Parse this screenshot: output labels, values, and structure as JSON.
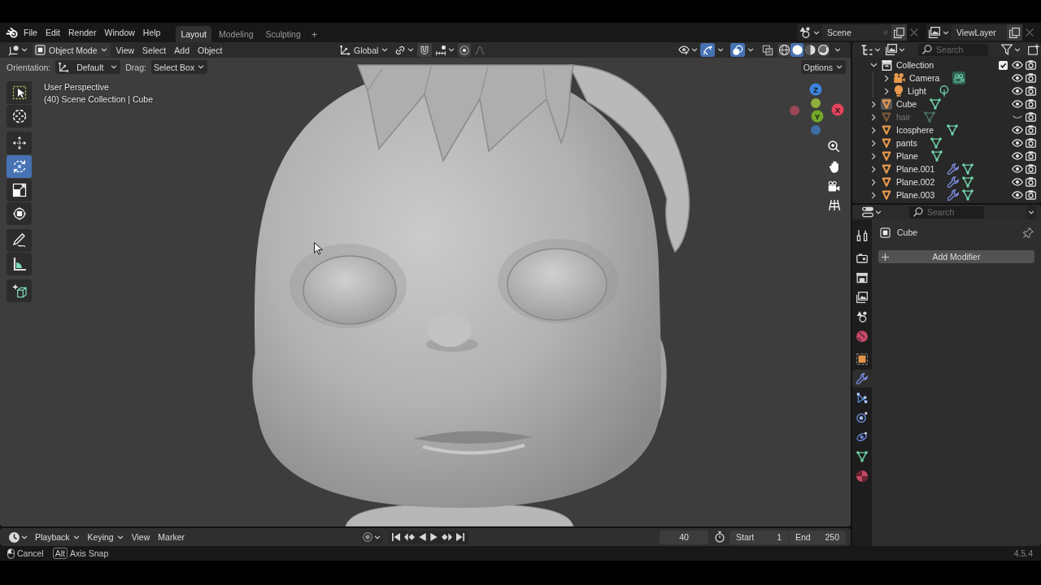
{
  "top_bar": {
    "menus": [
      "File",
      "Edit",
      "Render",
      "Window",
      "Help"
    ],
    "workspaces": [
      {
        "label": "Layout",
        "selected": true
      },
      {
        "label": "Modeling",
        "selected": false
      },
      {
        "label": "Sculpting",
        "selected": false
      }
    ],
    "add_workspace": "+",
    "scene": "Scene",
    "view_layer": "ViewLayer"
  },
  "viewport_header": {
    "mode": "Object Mode",
    "menus": [
      "View",
      "Select",
      "Add",
      "Object"
    ],
    "orientation": "Global",
    "toggles": [
      {
        "kind": "visibility",
        "on": false
      },
      {
        "kind": "gizmos",
        "on": true
      },
      {
        "kind": "overlays",
        "on": true
      },
      {
        "kind": "xray",
        "on": false
      }
    ],
    "shading": [
      {
        "kind": "wireframe",
        "selected": false
      },
      {
        "kind": "solid",
        "selected": true
      },
      {
        "kind": "material",
        "selected": false
      },
      {
        "kind": "rendered",
        "selected": false
      }
    ]
  },
  "tool_settings": {
    "orientation_label": "Orientation:",
    "orientation": "Default",
    "drag_label": "Drag:",
    "drag": "Select Box",
    "options": "Options"
  },
  "toolbar": {
    "groups": [
      [
        {
          "kind": "select_box",
          "selected": false
        },
        {
          "kind": "cursor",
          "selected": false
        }
      ],
      [
        {
          "kind": "move",
          "selected": false
        },
        {
          "kind": "rotate",
          "selected": true
        },
        {
          "kind": "scale",
          "selected": false
        },
        {
          "kind": "transform",
          "selected": false
        }
      ],
      [
        {
          "kind": "annotate",
          "selected": false
        },
        {
          "kind": "measure",
          "selected": false
        }
      ],
      [
        {
          "kind": "add_cube",
          "selected": false
        }
      ]
    ]
  },
  "viewport": {
    "info": [
      "User Perspective",
      "(40) Scene Collection | Cube"
    ],
    "gizmo": [
      {
        "label": "Z",
        "color": "#3c84dc"
      },
      {
        "color": "#8fae3c"
      },
      {
        "label": "X",
        "color": "#e2445c"
      },
      {
        "color": "#9c4656"
      },
      {
        "label": "Y",
        "color": "#72a82a"
      },
      {
        "color": "#3f6ea6"
      }
    ]
  },
  "outliner": {
    "search_placeholder": "Search",
    "tree": [
      {
        "kind": "collection",
        "name": "Collection",
        "expanded": true,
        "checked": true,
        "visible": true,
        "active": false,
        "children": [
          {
            "kind": "camera",
            "name": "Camera",
            "expanded": false,
            "visible": true,
            "active": false
          },
          {
            "kind": "light",
            "name": "Light",
            "expanded": false,
            "visible": true,
            "active": false
          }
        ]
      },
      {
        "kind": "mesh",
        "name": "Cube",
        "expanded": false,
        "visible": true,
        "active": true,
        "modifiers": false
      },
      {
        "kind": "mesh",
        "name": "hair",
        "expanded": false,
        "visible": false,
        "active": false,
        "modifiers": false
      },
      {
        "kind": "mesh",
        "name": "Icosphere",
        "expanded": false,
        "visible": true,
        "active": false,
        "modifiers": false
      },
      {
        "kind": "mesh",
        "name": "pants",
        "expanded": false,
        "visible": true,
        "active": false,
        "modifiers": false
      },
      {
        "kind": "mesh",
        "name": "Plane",
        "expanded": false,
        "visible": true,
        "active": false,
        "modifiers": false
      },
      {
        "kind": "mesh",
        "name": "Plane.001",
        "expanded": false,
        "visible": true,
        "active": false,
        "modifiers": true
      },
      {
        "kind": "mesh",
        "name": "Plane.002",
        "expanded": false,
        "visible": true,
        "active": false,
        "modifiers": true
      },
      {
        "kind": "mesh",
        "name": "Plane.003",
        "expanded": false,
        "visible": true,
        "active": false,
        "modifiers": true
      }
    ]
  },
  "properties": {
    "search_placeholder": "Search",
    "tab_groups": [
      [
        {
          "kind": "tool",
          "selected": false
        }
      ],
      [
        {
          "kind": "render",
          "selected": false
        },
        {
          "kind": "output",
          "selected": false
        },
        {
          "kind": "view_layer",
          "selected": false
        },
        {
          "kind": "scene",
          "selected": false
        },
        {
          "kind": "world",
          "selected": false
        }
      ],
      [
        {
          "kind": "object",
          "selected": false
        },
        {
          "kind": "modifiers",
          "selected": true
        },
        {
          "kind": "particles",
          "selected": false
        },
        {
          "kind": "physics",
          "selected": false
        },
        {
          "kind": "constraints",
          "selected": false
        },
        {
          "kind": "data",
          "selected": false
        },
        {
          "kind": "material",
          "selected": false
        }
      ]
    ],
    "object_name": "Cube",
    "add_modifier": "Add Modifier"
  },
  "timeline": {
    "menus": [
      {
        "label": "Playback",
        "dropdown": true
      },
      {
        "label": "Keying",
        "dropdown": true
      },
      {
        "label": "View",
        "dropdown": false
      },
      {
        "label": "Marker",
        "dropdown": false
      }
    ],
    "auto_keying": false,
    "current_frame": "40",
    "start_label": "Start",
    "start": "1",
    "end_label": "End",
    "end": "250"
  },
  "status_bar": {
    "hints": [
      {
        "kind": "mouse",
        "label": "Cancel"
      },
      {
        "kind": "key",
        "key": "Alt",
        "label": "Axis Snap"
      }
    ],
    "version": "4.5.4"
  }
}
